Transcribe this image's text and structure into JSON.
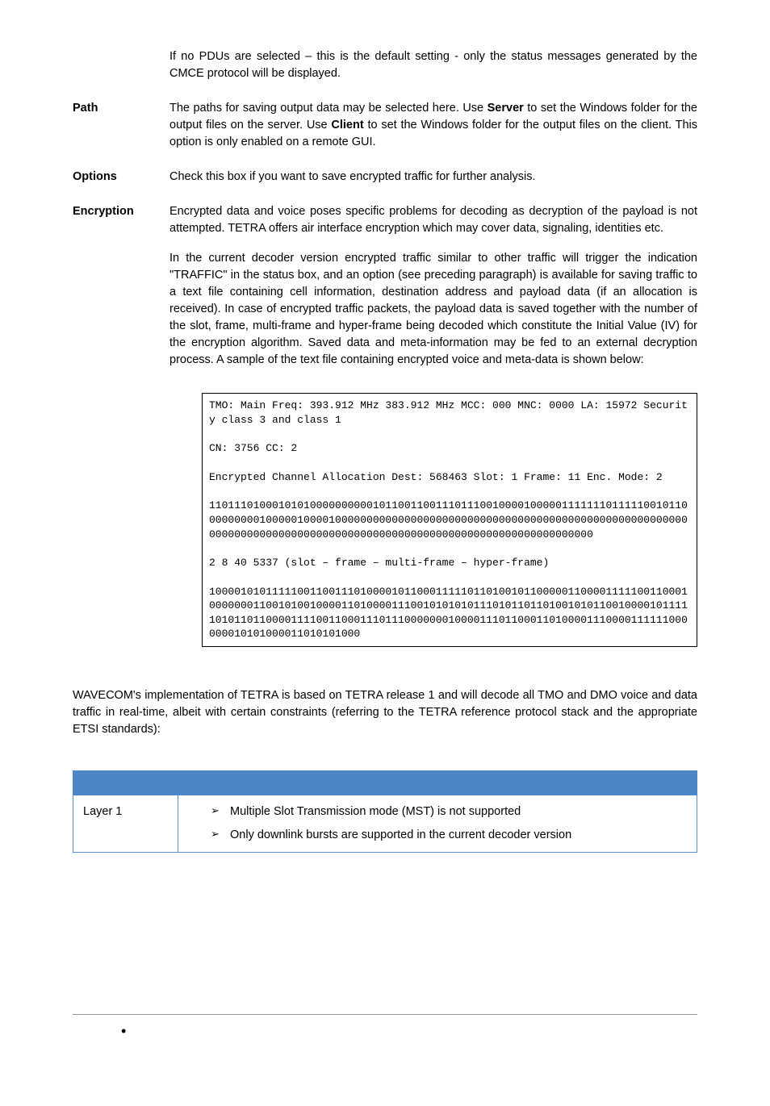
{
  "intro": "If no PDUs are selected – this is the default setting - only the status messages generated by the CMCE protocol will be displayed.",
  "defs": [
    {
      "term": "Path",
      "paras": [
        {
          "segments": [
            {
              "t": "The paths for saving output data may be selected here. Use "
            },
            {
              "t": "Server",
              "b": true
            },
            {
              "t": " to set the Windows folder for the output files on the server. Use "
            },
            {
              "t": "Client",
              "b": true
            },
            {
              "t": " to set the Windows folder for the output files on the client. This option is only enabled on a remote GUI."
            }
          ]
        }
      ]
    },
    {
      "term": "Options",
      "paras": [
        {
          "segments": [
            {
              "t": "Check this box if you want to save encrypted traffic for further analysis."
            }
          ]
        }
      ]
    },
    {
      "term": "Encryption",
      "paras": [
        {
          "segments": [
            {
              "t": "Encrypted data and voice poses specific problems for decoding as decryption of the payload is not attempted. TETRA offers air interface encryption which may cover data, signaling, identities etc."
            }
          ]
        },
        {
          "segments": [
            {
              "t": "In the current decoder version encrypted traffic similar to other traffic will trigger the indication \"TRAFFIC\" in the status box, and an option (see preceding paragraph) is available for saving traffic to a text file containing cell information, destination address and payload data (if an allocation is received). In case of encrypted traffic packets, the payload data is saved together with the number of the slot, frame, multi-frame and hyper-frame being decoded which constitute the Initial Value (IV) for the encryption algorithm. Saved data and meta-information may be fed to an external decryption process. A sample of the text file containing encrypted voice and meta-data is shown below:"
            }
          ]
        }
      ]
    }
  ],
  "code": {
    "lines": [
      "TMO: Main Freq: 393.912 MHz 383.912 MHz MCC: 000 MNC: 0000 LA: 15972 Security class 3 and class 1",
      "CN: 3756 CC: 2",
      "Encrypted Channel Allocation Dest: 568463 Slot: 1 Frame: 11 Enc. Mode: 2",
      "110111010001010100000000001011001100111011100100001000001111111011111001011000000000100000100001000000000000000000000000000000000000000000000000000000000000000000000000000000000000000000000000000000000000000000000",
      "2 8 40 5337 (slot – frame – multi-frame – hyper-frame)",
      "100001010111110011001110100001011000111110110100101100000110000111110011000100000001100101001000011010000111001010101011101011011010010101100100001011111010110110000111100110001110111000000010000111011000110100001110000111111000000010101000011010101000"
    ]
  },
  "summary": "WAVECOM's implementation of TETRA is based on TETRA release 1 and will decode all TMO and DMO voice and data traffic in real-time, albeit with certain constraints (referring to the TETRA reference protocol stack and the appropriate ETSI standards):",
  "table": {
    "rows": [
      {
        "layer": "Layer 1",
        "items": [
          "Multiple Slot Transmission mode (MST) is not supported",
          "Only downlink bursts are supported in the current decoder version"
        ]
      }
    ]
  },
  "footer_bullet": "•"
}
